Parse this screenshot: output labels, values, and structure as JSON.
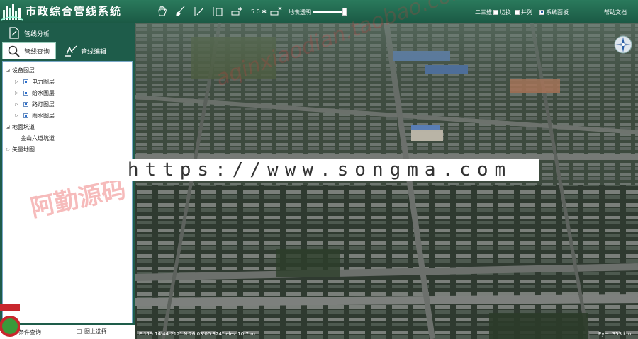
{
  "app": {
    "title": "市政综合管线系统"
  },
  "toolbar": {
    "tools": [
      "pan-hand-icon",
      "brush-icon",
      "measure-line-icon",
      "measure-area-icon",
      "add-point-icon",
      "clear-icon"
    ],
    "scale_value": "5.0 ✱",
    "transparency_label": "地表透明",
    "transparency_level": 0.95,
    "options": [
      {
        "label": "二三维",
        "checked": null
      },
      {
        "label": "切换",
        "checked": false
      },
      {
        "label": "并列",
        "checked": false
      },
      {
        "label": "系统面板",
        "checked": true
      }
    ],
    "help_label": "帮助文档"
  },
  "sidebar": {
    "header_label": "管线分析",
    "tabs": [
      {
        "label": "管线查询",
        "active": true
      },
      {
        "label": "管线编辑",
        "active": false
      }
    ],
    "tree": [
      {
        "label": "设备图层",
        "level": 0,
        "expanded": true
      },
      {
        "label": "电力图层",
        "level": 1,
        "checked": true
      },
      {
        "label": "给水图层",
        "level": 1,
        "checked": true
      },
      {
        "label": "路灯图层",
        "level": 1,
        "checked": true
      },
      {
        "label": "雨水图层",
        "level": 1,
        "checked": true
      },
      {
        "label": "地面坑道",
        "level": 0,
        "expanded": true
      },
      {
        "label": "金山六道坑道",
        "level": 1
      },
      {
        "label": "矢量地图",
        "level": 0,
        "expanded": false
      }
    ],
    "bottom": {
      "query_label": "条件查询",
      "map_select_label": "图上选择"
    }
  },
  "map": {
    "coords_text": "E 119.14'44.212\"  N 26.03'00.324\"  elev 10.7 m",
    "eye_text": "Eye:  .353 km"
  },
  "watermarks": {
    "url": "https://www.songma.com",
    "cn": "阿勤源码",
    "diag": "aqinxiaodian.taobao.com"
  },
  "colors": {
    "chrome": "#1e5c4a",
    "chrome_light": "#2a7a5c",
    "tree_border": "#7aa8c8"
  }
}
